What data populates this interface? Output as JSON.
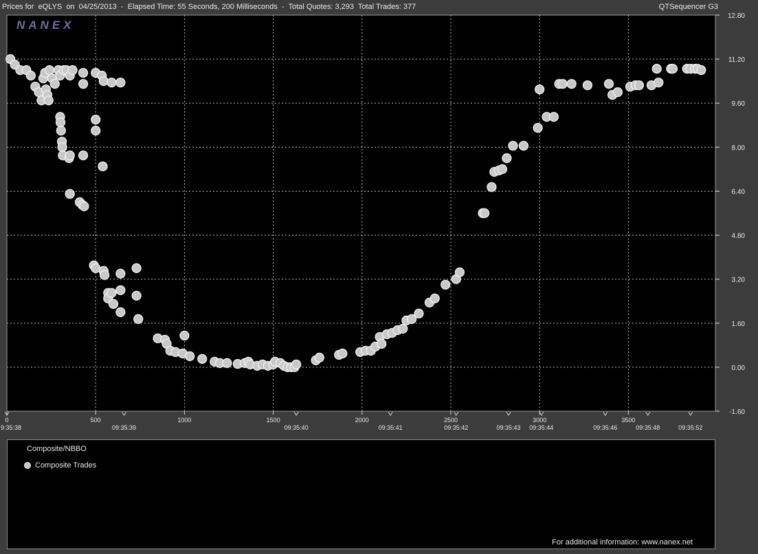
{
  "header": {
    "left_text": "Prices for  eQLYS  on  04/25/2013  -  Elapsed Time: 55 Seconds, 200 Milliseconds  -  Total Quotes: 3,293  Total Trades: 377",
    "right_text": "QTSequencer G3"
  },
  "logo": {
    "text": "NANEX"
  },
  "legend": {
    "title": "Composite/NBBO",
    "items": [
      {
        "label": "Composite Trades",
        "color": "#c8c8c8"
      }
    ]
  },
  "footer": {
    "text": "For additional information: www.nanex.net"
  },
  "colors": {
    "plot_bg": "#000000",
    "frame_bg": "#3c3c3c",
    "grid": "#bdbdbd",
    "point_fill": "#c8c8c8",
    "point_stroke": "#f5f5f5"
  },
  "chart_data": {
    "type": "scatter",
    "title": "",
    "xlabel": "",
    "ylabel": "",
    "xlim": [
      0,
      3990
    ],
    "ylim": [
      -1.6,
      12.8
    ],
    "grid": true,
    "legend_placement": "bottom-panel",
    "x_ticks": [
      0,
      500,
      1000,
      1500,
      2000,
      2500,
      3000,
      3500
    ],
    "x_tick_labels": [
      "0",
      "500",
      "1000",
      "1500",
      "2000",
      "2500",
      "3000",
      "3500"
    ],
    "y_ticks": [
      -1.6,
      0,
      1.6,
      3.2,
      4.8,
      6.4,
      8,
      9.6,
      11.2,
      12.8
    ],
    "y_tick_labels": [
      "-1.60",
      "0.00",
      "1.60",
      "3.20",
      "4.80",
      "6.40",
      "8.00",
      "9.60",
      "11.20",
      "12.80"
    ],
    "time_labels": [
      {
        "x": 0,
        "label": "9:35:38"
      },
      {
        "x": 660,
        "label": "09:35:39"
      },
      {
        "x": 1630,
        "label": "09:35:40"
      },
      {
        "x": 2160,
        "label": "09:35:41"
      },
      {
        "x": 2530,
        "label": "09:35:42"
      },
      {
        "x": 2825,
        "label": "09:35:43"
      },
      {
        "x": 3010,
        "label": "09:35:44"
      },
      {
        "x": 3370,
        "label": "09:35:46"
      },
      {
        "x": 3610,
        "label": "09:35:48"
      },
      {
        "x": 3850,
        "label": "09:35:52"
      }
    ],
    "series": [
      {
        "name": "Composite Trades",
        "points": [
          [
            20,
            11.2
          ],
          [
            45,
            11.0
          ],
          [
            75,
            10.8
          ],
          [
            110,
            10.8
          ],
          [
            135,
            10.6
          ],
          [
            160,
            10.2
          ],
          [
            180,
            10.0
          ],
          [
            195,
            9.7
          ],
          [
            205,
            10.5
          ],
          [
            215,
            10.7
          ],
          [
            220,
            10.1
          ],
          [
            228,
            9.9
          ],
          [
            235,
            9.7
          ],
          [
            240,
            10.8
          ],
          [
            255,
            10.5
          ],
          [
            270,
            10.3
          ],
          [
            290,
            10.8
          ],
          [
            300,
            10.6
          ],
          [
            320,
            10.8
          ],
          [
            335,
            10.8
          ],
          [
            355,
            10.6
          ],
          [
            370,
            10.8
          ],
          [
            430,
            10.7
          ],
          [
            430,
            10.3
          ],
          [
            500,
            10.7
          ],
          [
            535,
            10.6
          ],
          [
            545,
            10.4
          ],
          [
            590,
            10.35
          ],
          [
            640,
            10.35
          ],
          [
            300,
            9.1
          ],
          [
            302,
            8.9
          ],
          [
            305,
            8.6
          ],
          [
            310,
            8.2
          ],
          [
            312,
            8.0
          ],
          [
            315,
            7.7
          ],
          [
            350,
            7.6
          ],
          [
            355,
            7.7
          ],
          [
            430,
            7.7
          ],
          [
            500,
            9.0
          ],
          [
            500,
            8.6
          ],
          [
            540,
            7.3
          ],
          [
            355,
            6.3
          ],
          [
            410,
            6.0
          ],
          [
            425,
            5.9
          ],
          [
            435,
            5.85
          ],
          [
            490,
            3.7
          ],
          [
            500,
            3.6
          ],
          [
            545,
            3.5
          ],
          [
            550,
            3.35
          ],
          [
            570,
            2.7
          ],
          [
            570,
            2.5
          ],
          [
            590,
            2.7
          ],
          [
            600,
            2.3
          ],
          [
            640,
            2.0
          ],
          [
            640,
            2.8
          ],
          [
            640,
            3.4
          ],
          [
            730,
            3.6
          ],
          [
            730,
            2.6
          ],
          [
            740,
            1.75
          ],
          [
            850,
            1.05
          ],
          [
            890,
            1.0
          ],
          [
            900,
            0.85
          ],
          [
            920,
            0.6
          ],
          [
            950,
            0.55
          ],
          [
            990,
            0.5
          ],
          [
            1000,
            1.15
          ],
          [
            1030,
            0.4
          ],
          [
            1100,
            0.3
          ],
          [
            1170,
            0.2
          ],
          [
            1200,
            0.15
          ],
          [
            1240,
            0.15
          ],
          [
            1300,
            0.12
          ],
          [
            1340,
            0.15
          ],
          [
            1360,
            0.2
          ],
          [
            1370,
            0.1
          ],
          [
            1410,
            0.05
          ],
          [
            1440,
            0.1
          ],
          [
            1470,
            0.05
          ],
          [
            1500,
            0.1
          ],
          [
            1510,
            0.2
          ],
          [
            1540,
            0.15
          ],
          [
            1560,
            0.05
          ],
          [
            1580,
            0.0
          ],
          [
            1600,
            0.0
          ],
          [
            1620,
            0.0
          ],
          [
            1630,
            0.1
          ],
          [
            1740,
            0.25
          ],
          [
            1760,
            0.35
          ],
          [
            1870,
            0.45
          ],
          [
            1890,
            0.5
          ],
          [
            1990,
            0.55
          ],
          [
            2020,
            0.6
          ],
          [
            2050,
            0.6
          ],
          [
            2075,
            0.75
          ],
          [
            2100,
            1.1
          ],
          [
            2110,
            0.85
          ],
          [
            2140,
            1.2
          ],
          [
            2170,
            1.25
          ],
          [
            2200,
            1.35
          ],
          [
            2230,
            1.4
          ],
          [
            2250,
            1.7
          ],
          [
            2280,
            1.75
          ],
          [
            2320,
            1.95
          ],
          [
            2380,
            2.35
          ],
          [
            2410,
            2.5
          ],
          [
            2470,
            3.0
          ],
          [
            2530,
            3.2
          ],
          [
            2550,
            3.45
          ],
          [
            2680,
            5.6
          ],
          [
            2690,
            5.6
          ],
          [
            2730,
            6.55
          ],
          [
            2745,
            7.1
          ],
          [
            2770,
            7.15
          ],
          [
            2790,
            7.2
          ],
          [
            2815,
            7.6
          ],
          [
            2850,
            8.05
          ],
          [
            2910,
            8.05
          ],
          [
            2990,
            8.7
          ],
          [
            3000,
            10.1
          ],
          [
            3040,
            9.1
          ],
          [
            3080,
            9.1
          ],
          [
            3110,
            10.3
          ],
          [
            3130,
            10.3
          ],
          [
            3180,
            10.3
          ],
          [
            3270,
            10.25
          ],
          [
            3390,
            10.3
          ],
          [
            3410,
            9.9
          ],
          [
            3440,
            10.0
          ],
          [
            3510,
            10.2
          ],
          [
            3540,
            10.25
          ],
          [
            3560,
            10.25
          ],
          [
            3630,
            10.25
          ],
          [
            3670,
            10.35
          ],
          [
            3660,
            10.85
          ],
          [
            3740,
            10.85
          ],
          [
            3750,
            10.85
          ],
          [
            3830,
            10.85
          ],
          [
            3850,
            10.85
          ],
          [
            3875,
            10.85
          ],
          [
            3890,
            10.85
          ],
          [
            3910,
            10.8
          ]
        ]
      }
    ]
  }
}
